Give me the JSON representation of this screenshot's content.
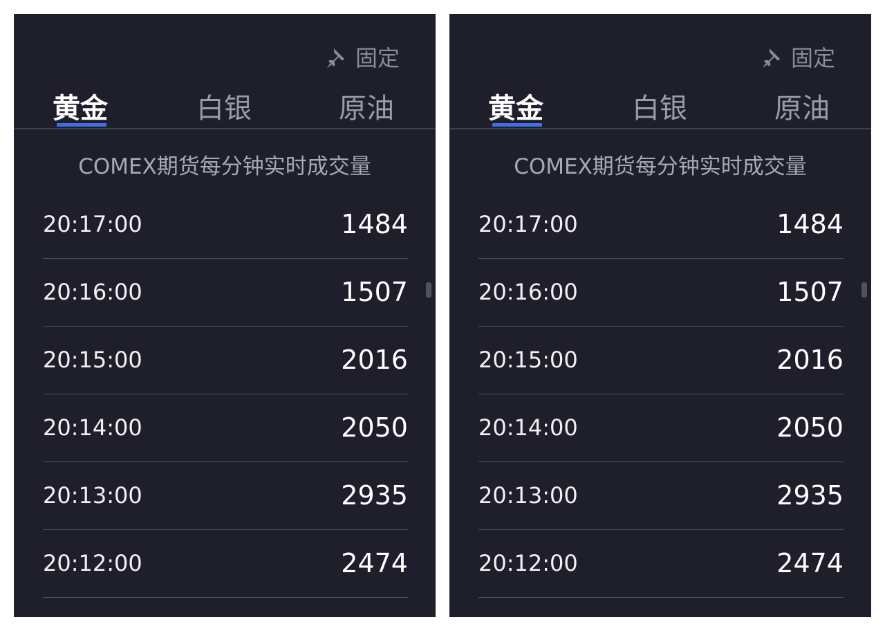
{
  "panels": [
    {
      "pin_label": "固定",
      "tabs": [
        {
          "label": "黄金",
          "active": true
        },
        {
          "label": "白银",
          "active": false
        },
        {
          "label": "原油",
          "active": false
        }
      ],
      "section_title": "COMEX期货每分钟实时成交量",
      "rows": [
        {
          "time": "20:17:00",
          "volume": "1484"
        },
        {
          "time": "20:16:00",
          "volume": "1507"
        },
        {
          "time": "20:15:00",
          "volume": "2016"
        },
        {
          "time": "20:14:00",
          "volume": "2050"
        },
        {
          "time": "20:13:00",
          "volume": "2935"
        },
        {
          "time": "20:12:00",
          "volume": "2474"
        }
      ]
    },
    {
      "pin_label": "固定",
      "tabs": [
        {
          "label": "黄金",
          "active": true
        },
        {
          "label": "白银",
          "active": false
        },
        {
          "label": "原油",
          "active": false
        }
      ],
      "section_title": "COMEX期货每分钟实时成交量",
      "rows": [
        {
          "time": "20:17:00",
          "volume": "1484"
        },
        {
          "time": "20:16:00",
          "volume": "1507"
        },
        {
          "time": "20:15:00",
          "volume": "2016"
        },
        {
          "time": "20:14:00",
          "volume": "2050"
        },
        {
          "time": "20:13:00",
          "volume": "2935"
        },
        {
          "time": "20:12:00",
          "volume": "2474"
        }
      ]
    }
  ],
  "icons": {
    "pin": "pin-icon"
  },
  "colors": {
    "panel_background": "#1e1f2b",
    "active_tab_indicator": "#3d6fe8",
    "inactive_tab_text": "#9a9ca8",
    "active_tab_text": "#ffffff"
  }
}
